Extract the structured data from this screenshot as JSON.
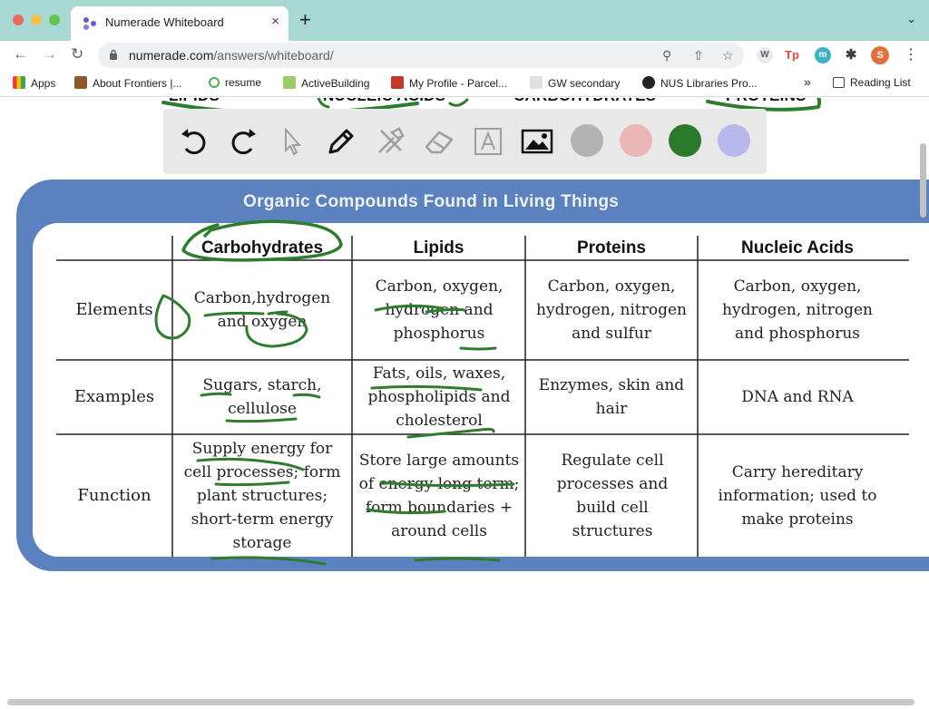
{
  "browser": {
    "tab_title": "Numerade Whiteboard",
    "tab_close": "×",
    "new_tab": "+",
    "tab_menu": "⌄",
    "url_host": "numerade.com",
    "url_path": "/answers/whiteboard/",
    "ext_w": "W",
    "ext_tp": "Tp",
    "ext_m": "m",
    "ext_profile": "S",
    "bookmarks": [
      {
        "label": "Apps"
      },
      {
        "label": "About Frontiers |..."
      },
      {
        "label": "resume"
      },
      {
        "label": "ActiveBuilding"
      },
      {
        "label": "My Profile - Parcel..."
      },
      {
        "label": "GW secondary"
      },
      {
        "label": "NUS Libraries Pro..."
      }
    ],
    "bookmarks_overflow": "»",
    "reading_list": "Reading List"
  },
  "whiteboard": {
    "top_labels": [
      "LIPIDS",
      "NUCLEIC ACIDS",
      "CARBOHYDRATES",
      "PROTEINS"
    ],
    "tools": [
      "undo-icon",
      "redo-icon",
      "pointer-icon",
      "pen-icon",
      "tools-icon",
      "eraser-icon",
      "text-icon",
      "image-icon"
    ],
    "swatches": [
      "#b3b3b3",
      "#ebb6b6",
      "#2b7a2b",
      "#b8b8ec"
    ],
    "ink_color": "#2e7d2e"
  },
  "table": {
    "title": "Organic Compounds Found in Living Things",
    "columns": [
      "Carbohydrates",
      "Lipids",
      "Proteins",
      "Nucleic Acids"
    ],
    "rows": [
      {
        "label": "Elements",
        "cells": [
          "Carbon,hydrogen and oxygen",
          "Carbon, oxygen, hydrogen and phosphorus",
          "Carbon, oxygen, hydrogen, nitrogen and sulfur",
          "Carbon, oxygen, hydrogen, nitrogen and phosphorus"
        ]
      },
      {
        "label": "Examples",
        "cells": [
          "Sugars, starch, cellulose",
          "Fats, oils, waxes, phospholipids and cholesterol",
          "Enzymes, skin and hair",
          "DNA and RNA"
        ]
      },
      {
        "label": "Function",
        "cells": [
          "Supply energy for cell processes; form plant structures; short-term energy storage",
          "Store large amounts of energy long term; form boundaries + around cells",
          "Regulate cell processes and build cell structures",
          "Carry hereditary information; used to make proteins"
        ]
      }
    ]
  }
}
